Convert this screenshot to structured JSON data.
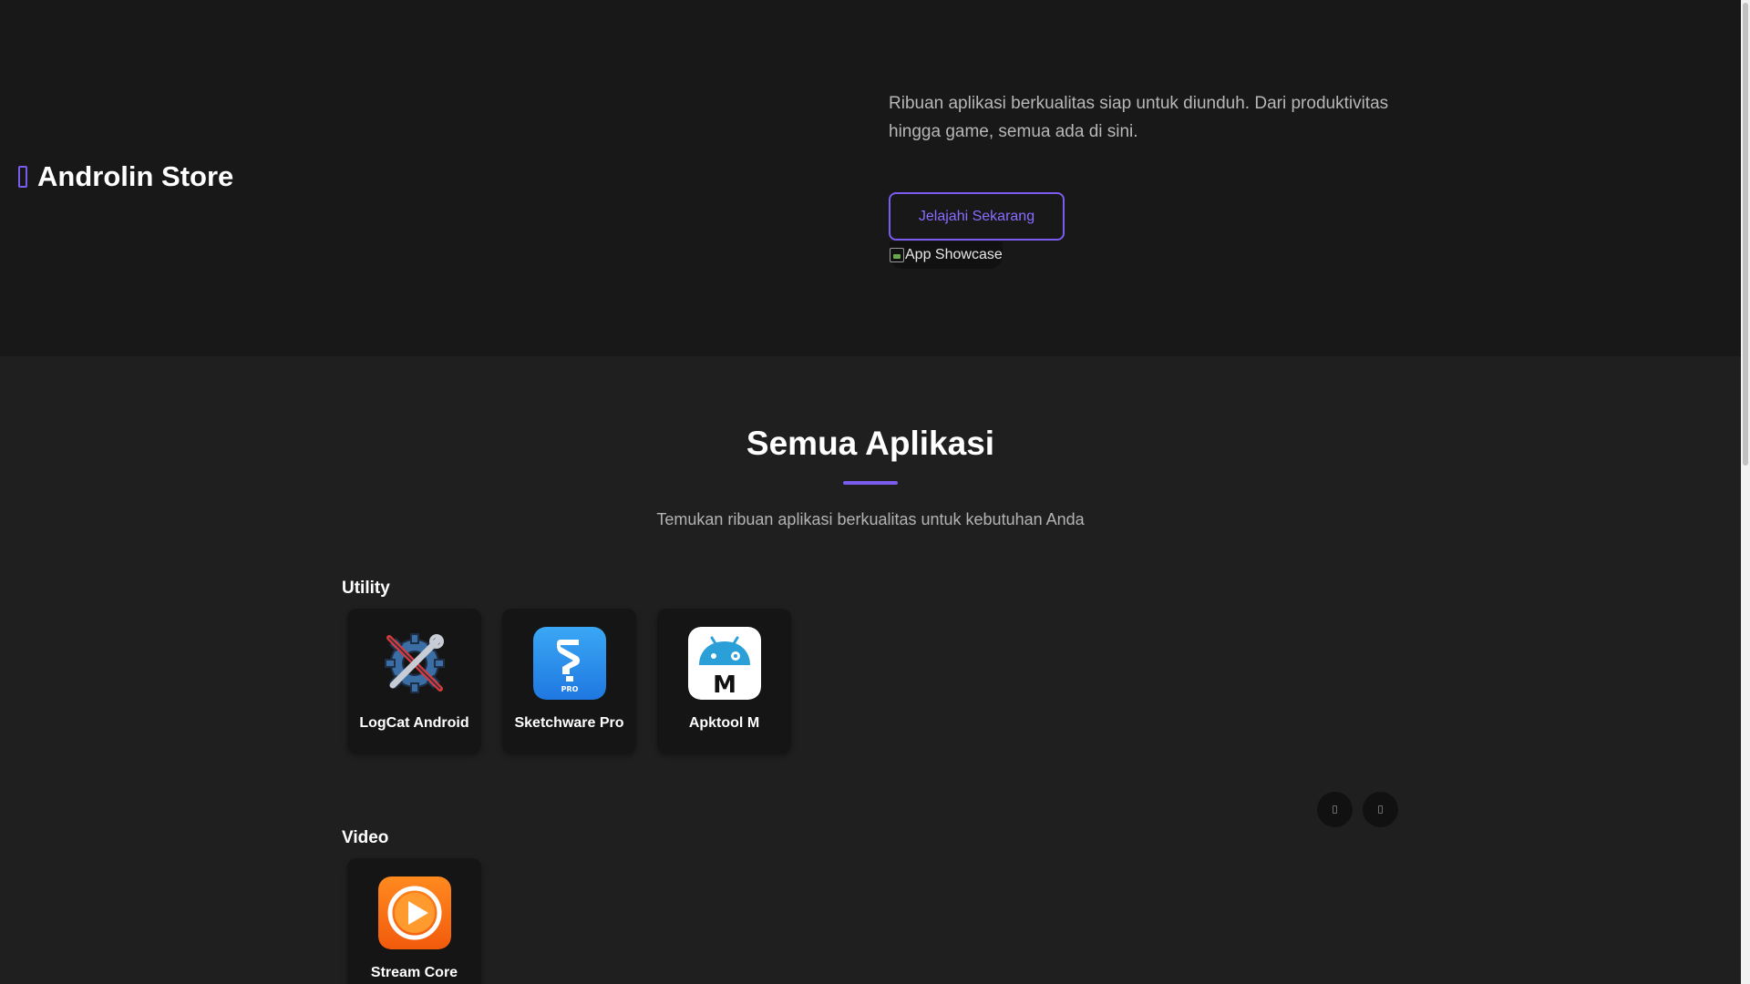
{
  "brand": {
    "name": "Androlin Store",
    "accent": "#7b5cf0"
  },
  "hero": {
    "description": "Ribuan aplikasi berkualitas siap untuk diunduh. Dari produktivitas hingga game, semua ada di sini.",
    "cta_label": "Jelajahi Sekarang",
    "showcase_alt": "App Showcase"
  },
  "section": {
    "title": "Semua Aplikasi",
    "subtitle": "Temukan ribuan aplikasi berkualitas untuk kebutuhan Anda"
  },
  "categories": [
    {
      "name": "Utility",
      "apps": [
        {
          "name": "LogCat Android",
          "icon": "logcat-tools-icon"
        },
        {
          "name": "Sketchware Pro",
          "icon": "sketchware-pro-icon",
          "icon_badge": "PRO"
        },
        {
          "name": "Apktool M",
          "icon": "apktool-m-icon",
          "icon_badge": "M"
        }
      ]
    },
    {
      "name": "Video",
      "apps": [
        {
          "name": "Stream Core",
          "icon": "stream-core-play-icon"
        }
      ]
    }
  ],
  "carousel": {
    "prev_icon": "chevron-left-icon",
    "next_icon": "chevron-right-icon"
  }
}
